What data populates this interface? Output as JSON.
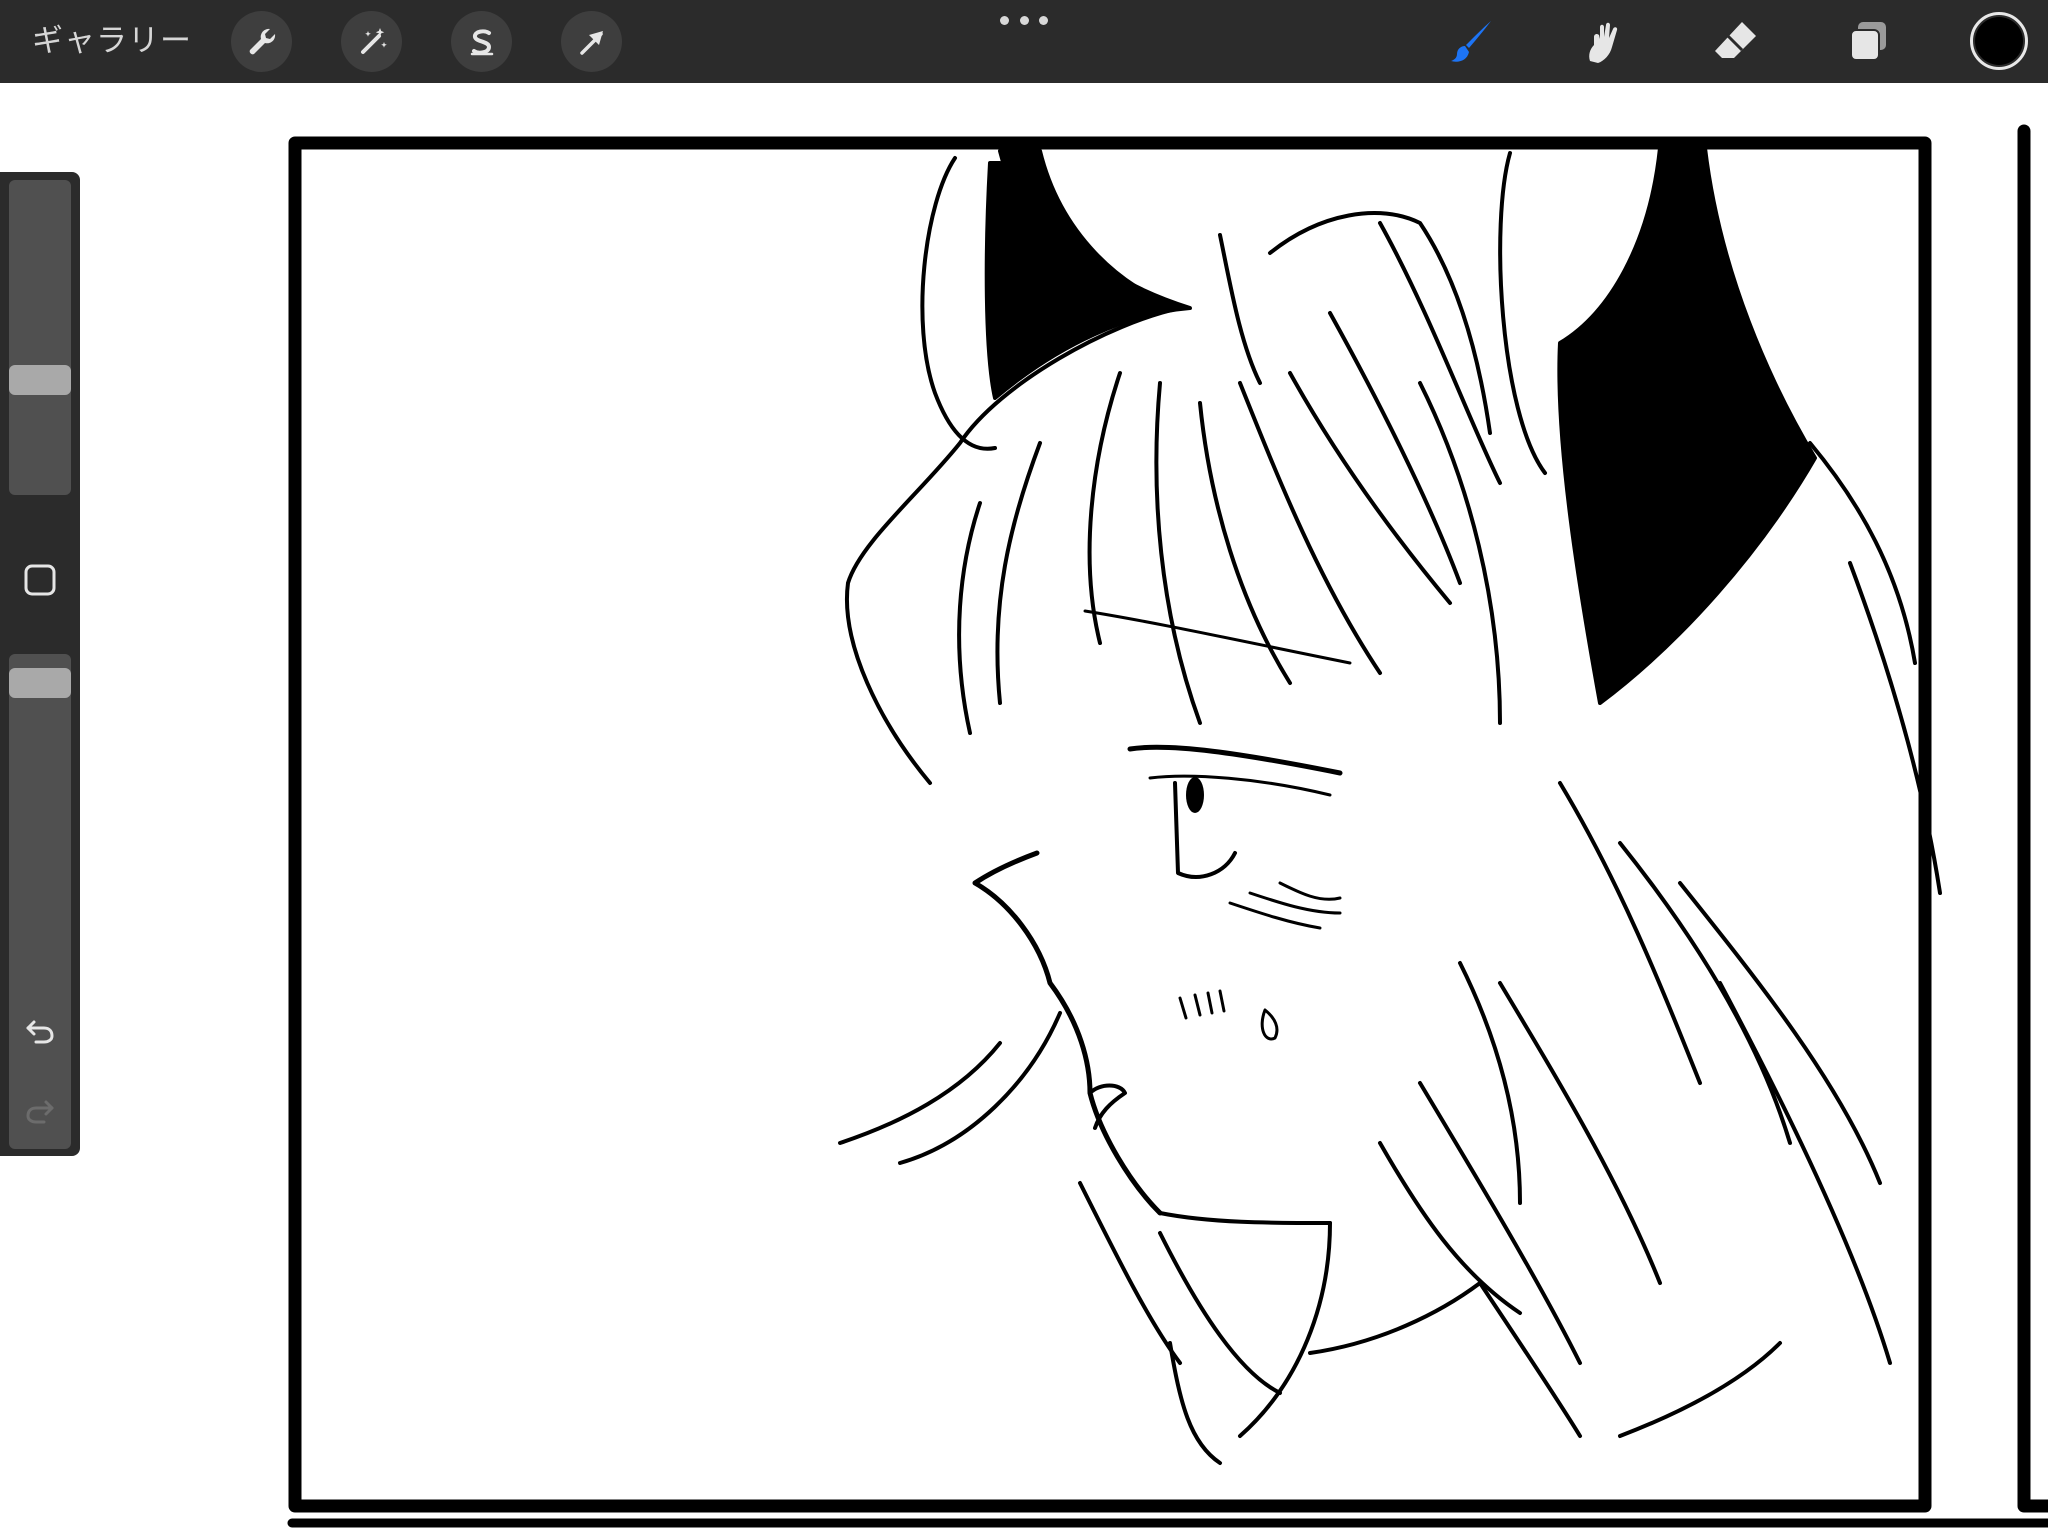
{
  "toolbar": {
    "gallery_label": "ギャラリー",
    "left_tools": [
      {
        "icon": "wrench-icon",
        "name": "actions-button"
      },
      {
        "icon": "magic-wand-icon",
        "name": "adjustments-button"
      },
      {
        "icon": "selection-s-icon",
        "name": "selection-button"
      },
      {
        "icon": "arrow-cursor-icon",
        "name": "transform-button"
      }
    ],
    "right_tools": [
      {
        "icon": "brush-icon",
        "name": "brush-button",
        "active": true
      },
      {
        "icon": "smudge-icon",
        "name": "smudge-button",
        "active": false
      },
      {
        "icon": "eraser-icon",
        "name": "eraser-button",
        "active": false
      },
      {
        "icon": "layers-icon",
        "name": "layers-button",
        "active": false
      }
    ],
    "current_color": "#000000",
    "active_color": "#1d74f5",
    "inactive_color": "#e6e6e6"
  },
  "sidebar": {
    "brush_size_level": 0.35,
    "brush_opacity_level": 0.97,
    "modify_icon": "square-outline-icon",
    "undo_icon": "undo-icon",
    "redo_icon": "redo-icon"
  }
}
